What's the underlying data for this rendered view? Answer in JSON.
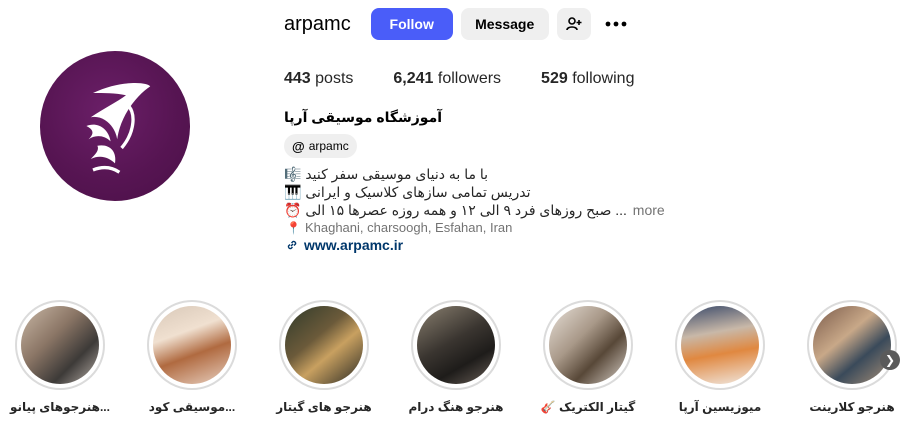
{
  "profile": {
    "username": "arpamc",
    "follow_label": "Follow",
    "message_label": "Message",
    "add_user_icon": "person-add-icon",
    "more_icon": "more-horizontal-icon",
    "stats": {
      "posts_count": "443",
      "posts_label": "posts",
      "followers_count": "6,241",
      "followers_label": "followers",
      "following_count": "529",
      "following_label": "following"
    },
    "full_name": "آموزشگاه موسیقی آرپا",
    "threads_handle": "arpamc",
    "bio_lines": [
      "🎼 با ما به دنیای موسیقی سفر کنید",
      "🎹 تدریس تمامی سازهای کلاسیک و ایرانی",
      "⏰ صبح روزهای فرد ۹ الی ۱۲ و همه روزه عصرها ۱۵ الی ..."
    ],
    "more_label": "more",
    "location": "Khaghani, charsoogh, Esfahan, Iran",
    "website": "www.arpamc.ir"
  },
  "stories": [
    {
      "label": "هنرجوهای پیانو..."
    },
    {
      "label": "موسیقی کود..."
    },
    {
      "label": "هنرجو های گیتار"
    },
    {
      "label": "هنرجو هنگ درام"
    },
    {
      "label": "🎸 گیتار الکتریک"
    },
    {
      "label": "میوزیسین آرپا"
    },
    {
      "label": "هنرجو کلارینت"
    }
  ],
  "colors": {
    "accent": "#4a5df9",
    "avatar_bg": "#571553",
    "link": "#00376b"
  }
}
